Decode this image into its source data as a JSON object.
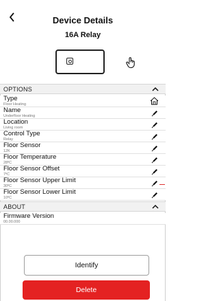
{
  "header": {
    "back_icon": "chevron-left-icon",
    "title": "Device Details",
    "subtitle": "16A Relay",
    "device_icon": "relay-device-icon",
    "identify_icon": "hand-pointer-icon"
  },
  "options": {
    "label": "OPTIONS",
    "icon": "chevron-up-icon",
    "rows": [
      {
        "label": "Type",
        "value": "Floor Heating",
        "icon": "home-icon"
      },
      {
        "label": "Name",
        "value": "Underfloor Heating",
        "icon": "pencil-icon"
      },
      {
        "label": "Location",
        "value": "Living room",
        "icon": "pencil-icon"
      },
      {
        "label": "Control Type",
        "value": "Relay",
        "icon": "pencil-icon"
      },
      {
        "label": "Floor Sensor",
        "value": "12K",
        "icon": "pencil-icon"
      },
      {
        "label": "Floor Temperature",
        "value": "28ºC",
        "icon": "pencil-icon"
      },
      {
        "label": "Floor Sensor Offset",
        "value": "7ºC",
        "icon": "pencil-icon"
      },
      {
        "label": "Floor Sensor Upper Limit",
        "value": "30ºC",
        "icon": "pencil-icon"
      },
      {
        "label": "Floor Sensor Lower Limit",
        "value": "10ºC",
        "icon": "pencil-icon"
      }
    ]
  },
  "about": {
    "label": "ABOUT",
    "icon": "chevron-up-icon",
    "firmware_label": "Firmware Version",
    "firmware_value": "00.00.000"
  },
  "actions": {
    "identify_label": "Identify",
    "delete_label": "Delete"
  },
  "colors": {
    "delete_bg": "#e42222",
    "section_bg": "#f1f1f1"
  }
}
